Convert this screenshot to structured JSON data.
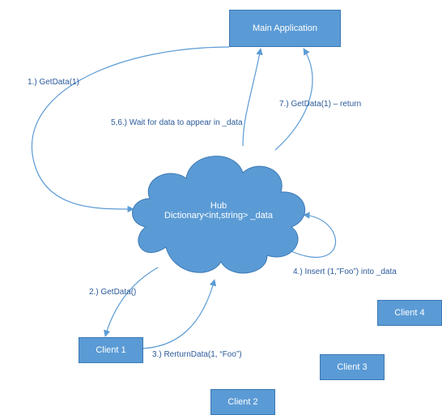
{
  "nodes": {
    "main_app": {
      "label": "Main Application"
    },
    "hub": {
      "title": "Hub",
      "subtitle": "Dictionary<int,string> _data"
    },
    "client1": {
      "label": "Client 1"
    },
    "client2": {
      "label": "Client 2"
    },
    "client3": {
      "label": "Client 3"
    },
    "client4": {
      "label": "Client 4"
    }
  },
  "edges": {
    "step1": "1.) GetData(1)",
    "step2": "2.) GetData()",
    "step3": "3.) RerturnData(1, “Foo”)",
    "step4": "4.) Insert (1,”Foo”) into _data",
    "step56": "5,6.) Wait for data to appear in _data",
    "step7": "7.) GetData(1) – return"
  },
  "colors": {
    "box_fill": "#5b9bd5",
    "box_border": "#3a78b5",
    "text_blue": "#2a5a9a"
  },
  "chart_data": {
    "type": "table",
    "title": "SignalR-style Hub data flow",
    "nodes": [
      "Main Application",
      "Hub (Dictionary<int,string> _data)",
      "Client 1",
      "Client 2",
      "Client 3",
      "Client 4"
    ],
    "steps": [
      {
        "n": 1,
        "from": "Main Application",
        "to": "Hub",
        "label": "GetData(1)"
      },
      {
        "n": 2,
        "from": "Hub",
        "to": "Client 1",
        "label": "GetData()"
      },
      {
        "n": 3,
        "from": "Client 1",
        "to": "Hub",
        "label": "RerturnData(1, \"Foo\")"
      },
      {
        "n": 4,
        "from": "Hub",
        "to": "Hub",
        "label": "Insert (1,\"Foo\") into _data"
      },
      {
        "n": 5,
        "from": "Hub",
        "to": "Main Application",
        "label": "Wait for data to appear in _data"
      },
      {
        "n": 6,
        "from": "Hub",
        "to": "Main Application",
        "label": "Wait for data to appear in _data"
      },
      {
        "n": 7,
        "from": "Hub",
        "to": "Main Application",
        "label": "GetData(1) – return"
      }
    ]
  }
}
